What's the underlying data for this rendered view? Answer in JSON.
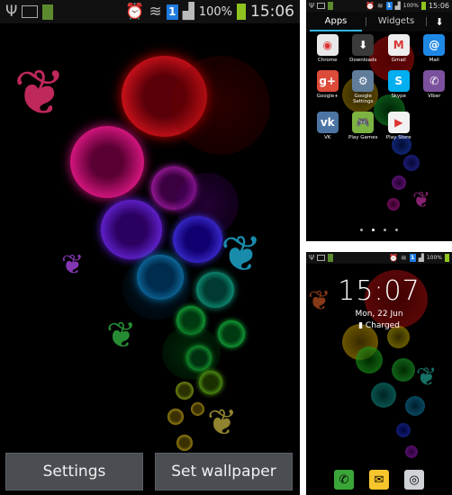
{
  "status_bar_left": {
    "time": "15:06",
    "battery_percent": "100%",
    "notif_battery_text": "100%",
    "sim_badge": "1"
  },
  "status_bar_drawer": {
    "time": "15:06",
    "battery_percent": "100%",
    "sim_badge": "1"
  },
  "status_bar_lock": {
    "battery_percent": "100%",
    "sim_badge": "1"
  },
  "preview_buttons": {
    "settings_label": "Settings",
    "set_wallpaper_label": "Set wallpaper"
  },
  "app_drawer": {
    "tabs": [
      {
        "label": "Apps",
        "active": true
      },
      {
        "label": "Widgets",
        "active": false
      }
    ],
    "download_icon": "download-icon",
    "apps": [
      {
        "label": "Chrome",
        "icon": "chrome-icon",
        "color": "#e8e8e8",
        "glyph": "◉"
      },
      {
        "label": "Downloads",
        "icon": "downloads-icon",
        "color": "#3a3a3a",
        "glyph": "⬇"
      },
      {
        "label": "Gmail",
        "icon": "gmail-icon",
        "color": "#eeeeee",
        "glyph": "M"
      },
      {
        "label": "Mail",
        "icon": "mail-icon",
        "color": "#1e88e5",
        "glyph": "@"
      },
      {
        "label": "Google+",
        "icon": "google-plus-icon",
        "color": "#dd4b39",
        "glyph": "g+"
      },
      {
        "label": "Google Settings",
        "icon": "google-settings-icon",
        "color": "#607d9b",
        "glyph": "⚙"
      },
      {
        "label": "Skype",
        "icon": "skype-icon",
        "color": "#00aff0",
        "glyph": "S"
      },
      {
        "label": "Viber",
        "icon": "viber-icon",
        "color": "#7b519d",
        "glyph": "✆"
      },
      {
        "label": "VK",
        "icon": "vk-icon",
        "color": "#4c75a3",
        "glyph": "vk"
      },
      {
        "label": "Play Games",
        "icon": "play-games-icon",
        "color": "#7cb342",
        "glyph": "🎮"
      },
      {
        "label": "Play Store",
        "icon": "play-store-icon",
        "color": "#f2f2f2",
        "glyph": "▶"
      }
    ],
    "page_count": 4,
    "active_page": 2
  },
  "lock_screen": {
    "clock": "15:07",
    "date": "Mon, 22 Jun",
    "charge_status": "Charged",
    "dock": [
      {
        "icon": "phone-icon",
        "color": "#3aa537",
        "glyph": "✆"
      },
      {
        "icon": "messages-icon",
        "color": "#f7c52c",
        "glyph": "✉"
      },
      {
        "icon": "camera-icon",
        "color": "#cfd2d6",
        "glyph": "◎"
      }
    ]
  }
}
